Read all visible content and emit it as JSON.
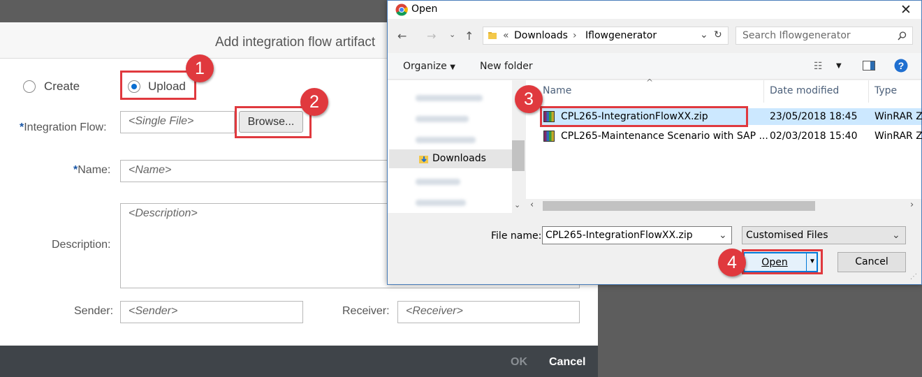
{
  "sap_dialog": {
    "title": "Add integration flow artifact",
    "radio_create": "Create",
    "radio_upload": "Upload",
    "integration_flow_label": "Integration Flow:",
    "integration_flow_placeholder": "<Single File>",
    "browse_label": "Browse...",
    "name_label": "Name:",
    "name_placeholder": "<Name>",
    "description_label": "Description:",
    "description_placeholder": "<Description>",
    "sender_label": "Sender:",
    "sender_placeholder": "<Sender>",
    "receiver_label": "Receiver:",
    "receiver_placeholder": "<Receiver>",
    "required_marker": "*",
    "ok_label": "OK",
    "cancel_label": "Cancel"
  },
  "open_dialog": {
    "title": "Open",
    "breadcrumb": [
      "«",
      "Downloads",
      "›",
      "Iflowgenerator"
    ],
    "search_placeholder": "Search Iflowgenerator",
    "organize_label": "Organize",
    "new_folder_label": "New folder",
    "nav_selected": "Downloads",
    "columns": [
      "Name",
      "Date modified",
      "Type"
    ],
    "files": [
      {
        "name": "CPL265-IntegrationFlowXX.zip",
        "date": "23/05/2018 18:45",
        "type": "WinRAR Z",
        "selected": true
      },
      {
        "name": "CPL265-Maintenance Scenario with SAP ...",
        "date": "02/03/2018 15:40",
        "type": "WinRAR Z",
        "selected": false
      }
    ],
    "file_name_label": "File name:",
    "file_name_value": "CPL265-IntegrationFlowXX.zip",
    "file_type_value": "Customised Files",
    "open_label": "Open",
    "cancel_label": "Cancel"
  },
  "annotations": [
    "1",
    "2",
    "3",
    "4"
  ],
  "colors": {
    "annotation_red": "#e0393e",
    "sap_footer": "#3f4449",
    "selection_blue": "#cce8ff"
  }
}
